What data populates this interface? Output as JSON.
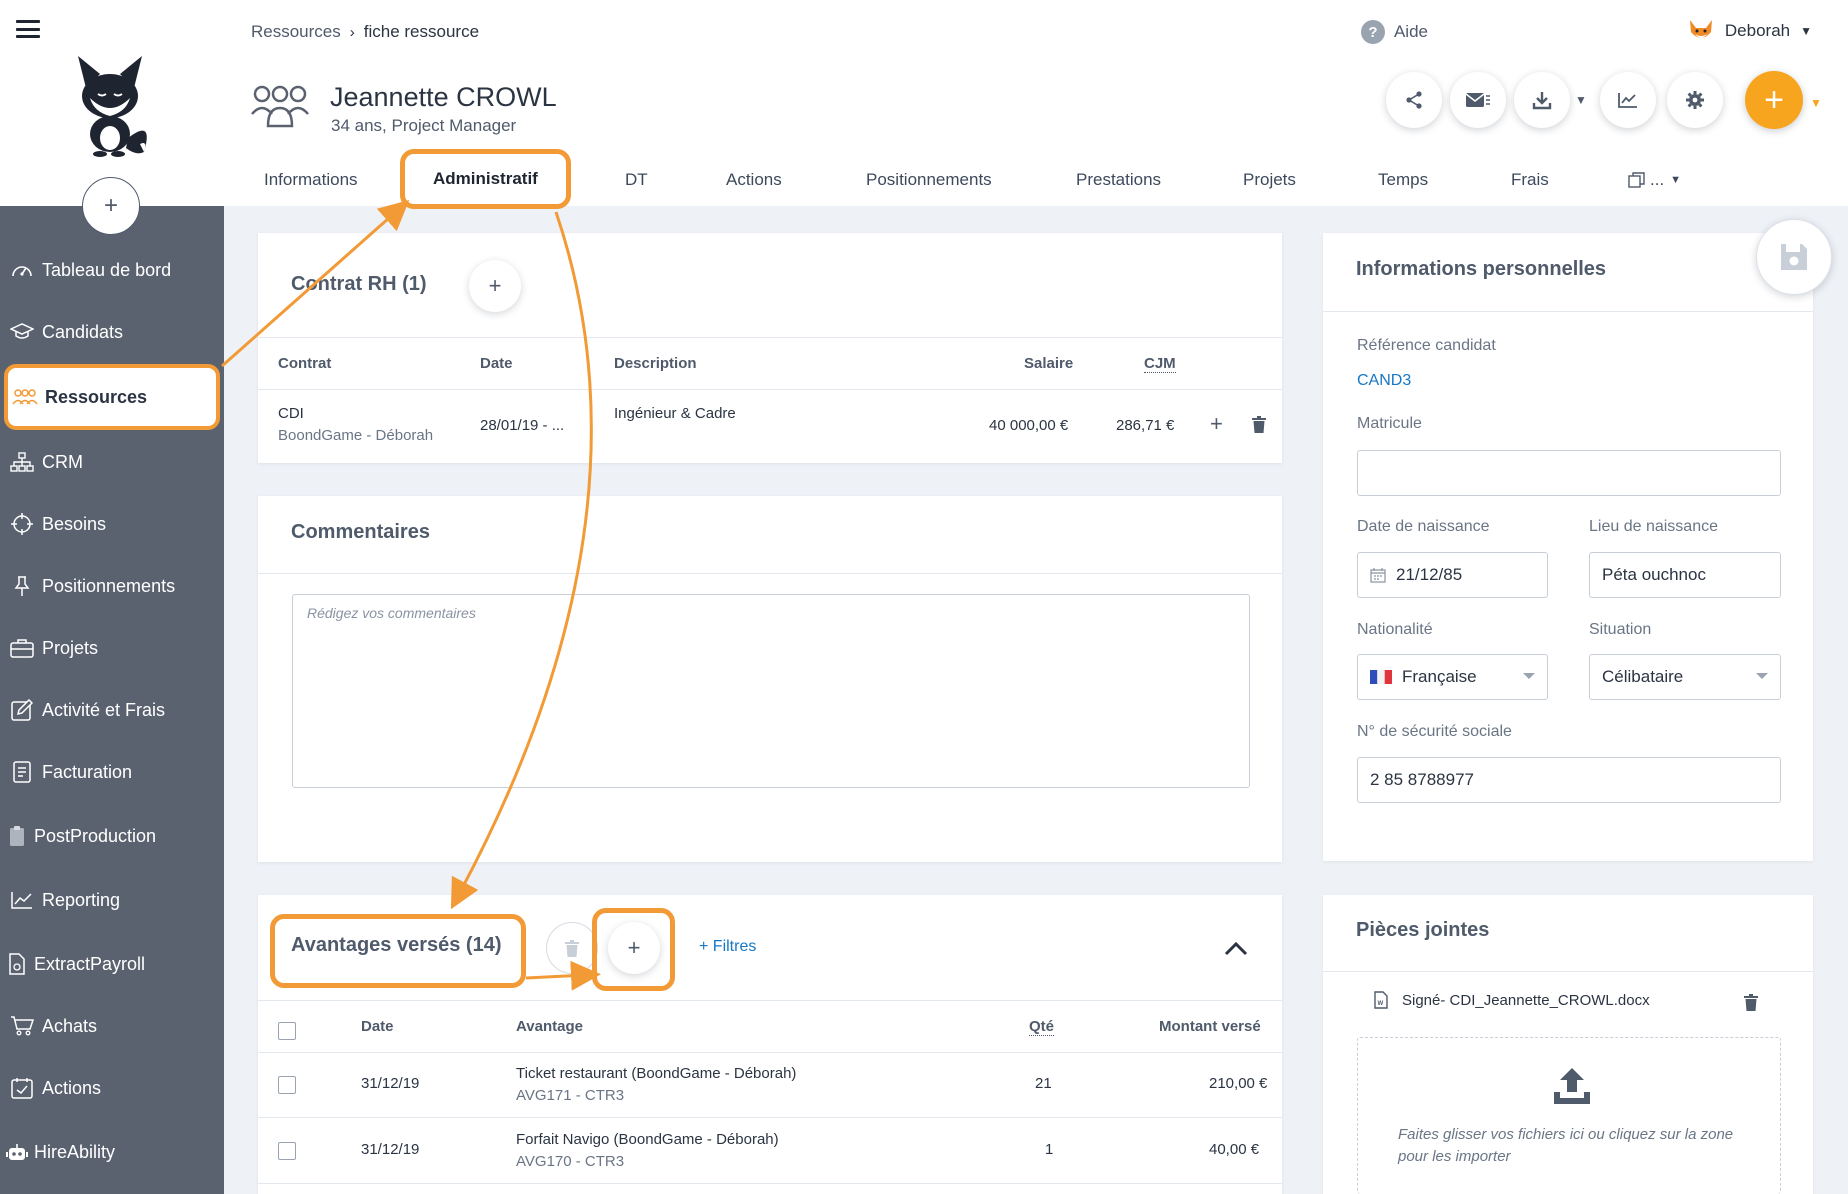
{
  "colors": {
    "sidebar": "#5a6270",
    "accent": "#f29a35",
    "add": "#f7a51e",
    "link": "#1677c4"
  },
  "sidebar": {
    "items": [
      {
        "label": "Tableau de bord",
        "icon": "dashboard-icon"
      },
      {
        "label": "Candidats",
        "icon": "graduation-cap-icon"
      },
      {
        "label": "Ressources",
        "icon": "people-icon"
      },
      {
        "label": "CRM",
        "icon": "org-chart-icon"
      },
      {
        "label": "Besoins",
        "icon": "crosshair-icon"
      },
      {
        "label": "Positionnements",
        "icon": "pin-icon"
      },
      {
        "label": "Projets",
        "icon": "briefcase-icon"
      },
      {
        "label": "Activité et Frais",
        "icon": "edit-icon"
      },
      {
        "label": "Facturation",
        "icon": "invoice-icon"
      },
      {
        "label": "PostProduction",
        "icon": "clipboard-icon"
      },
      {
        "label": "Reporting",
        "icon": "chart-icon"
      },
      {
        "label": "ExtractPayroll",
        "icon": "document-icon"
      },
      {
        "label": "Achats",
        "icon": "cart-icon"
      },
      {
        "label": "Actions",
        "icon": "calendar-check-icon"
      },
      {
        "label": "HireAbility",
        "icon": "robot-icon"
      }
    ]
  },
  "header": {
    "breadcrumb": [
      "Ressources",
      "fiche ressource"
    ],
    "help_label": "Aide",
    "user_name": "Deborah",
    "resource_name": "Jeannette CROWL",
    "resource_sub": "34 ans, Project Manager"
  },
  "tabs": [
    "Informations",
    "Administratif",
    "DT",
    "Actions",
    "Positionnements",
    "Prestations",
    "Projets",
    "Temps",
    "Frais",
    "..."
  ],
  "contrat": {
    "title": "Contrat RH (1)",
    "headers": [
      "Contrat",
      "Date",
      "Description",
      "Salaire",
      "CJM"
    ],
    "row": {
      "contrat": "CDI",
      "contrat_sub": "BoondGame - Déborah",
      "date": "28/01/19 - ...",
      "description": "Ingénieur & Cadre",
      "salaire": "40 000,00 €",
      "cjm": "286,71 €"
    }
  },
  "commentaires": {
    "title": "Commentaires",
    "placeholder": "Rédigez vos commentaires"
  },
  "avantages": {
    "title": "Avantages versés (14)",
    "filters_label": "+ Filtres",
    "headers": [
      "Date",
      "Avantage",
      "Qté",
      "Montant versé"
    ],
    "rows": [
      {
        "date": "31/12/19",
        "avantage": "Ticket restaurant (BoondGame - Déborah)",
        "ref": "AVG171 - CTR3",
        "qte": "21",
        "montant": "210,00 €"
      },
      {
        "date": "31/12/19",
        "avantage": "Forfait Navigo (BoondGame - Déborah)",
        "ref": "AVG170 - CTR3",
        "qte": "1",
        "montant": "40,00 €"
      }
    ]
  },
  "infos": {
    "title": "Informations personnelles",
    "ref_label": "Référence candidat",
    "ref_value": "CAND3",
    "matricule_label": "Matricule",
    "matricule_value": "",
    "naissance_label": "Date de naissance",
    "naissance_value": "21/12/85",
    "lieu_label": "Lieu de naissance",
    "lieu_value": "Péta ouchnoc",
    "nationalite_label": "Nationalité",
    "nationalite_value": "Française",
    "situation_label": "Situation",
    "situation_value": "Célibataire",
    "secu_label": "N° de sécurité sociale",
    "secu_value": "2 85 8788977"
  },
  "pieces": {
    "title": "Pièces jointes",
    "file": "Signé- CDI_Jeannette_CROWL.docx",
    "drop_text": "Faites glisser vos fichiers ici ou cliquez sur la zone pour les importer"
  }
}
